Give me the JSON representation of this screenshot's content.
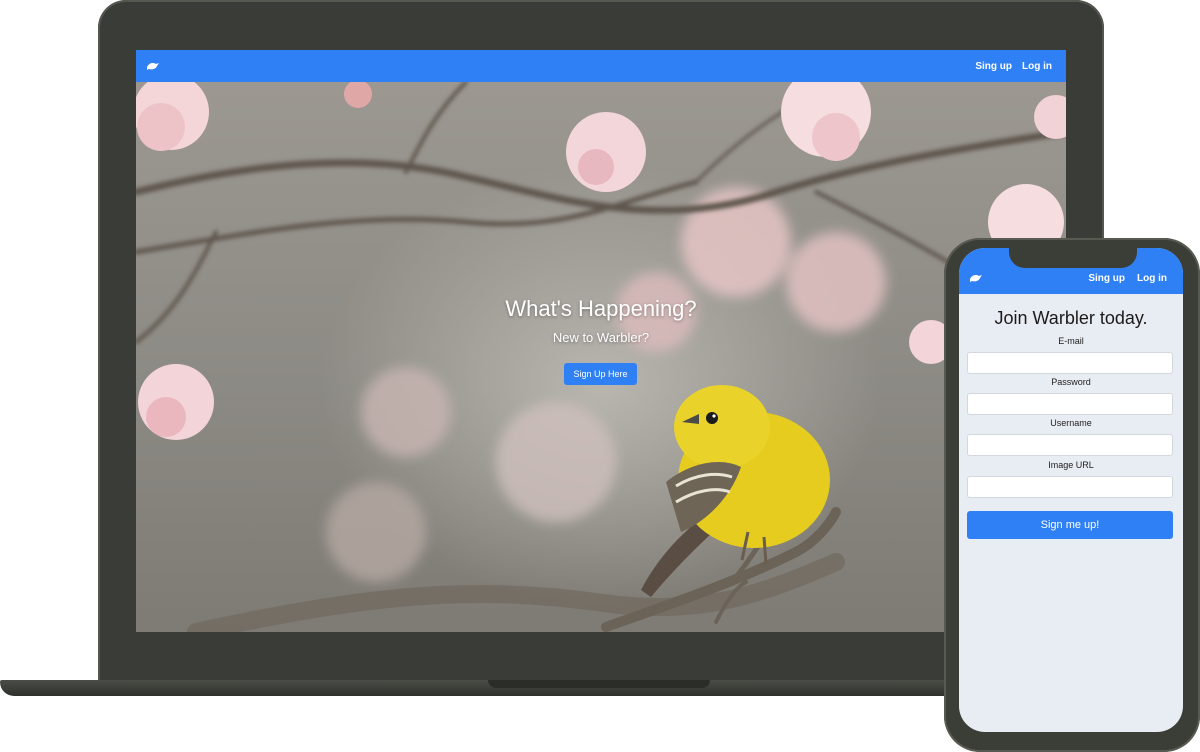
{
  "desktop": {
    "nav": {
      "signup": "Sing up",
      "login": "Log in"
    },
    "hero": {
      "title": "What's Happening?",
      "subtitle": "New to Warbler?",
      "button": "Sign Up Here"
    }
  },
  "mobile": {
    "nav": {
      "signup": "Sing up",
      "login": "Log in"
    },
    "form": {
      "title": "Join Warbler today.",
      "email_label": "E-mail",
      "password_label": "Password",
      "username_label": "Username",
      "image_label": "Image URL",
      "submit": "Sign me up!"
    }
  },
  "colors": {
    "brand": "#2f80f5",
    "device": "#3a3c37",
    "phone_bg": "#e8ecf3",
    "bird": "#e6cc1e"
  },
  "icons": {
    "logo": "bird-logo-icon"
  }
}
